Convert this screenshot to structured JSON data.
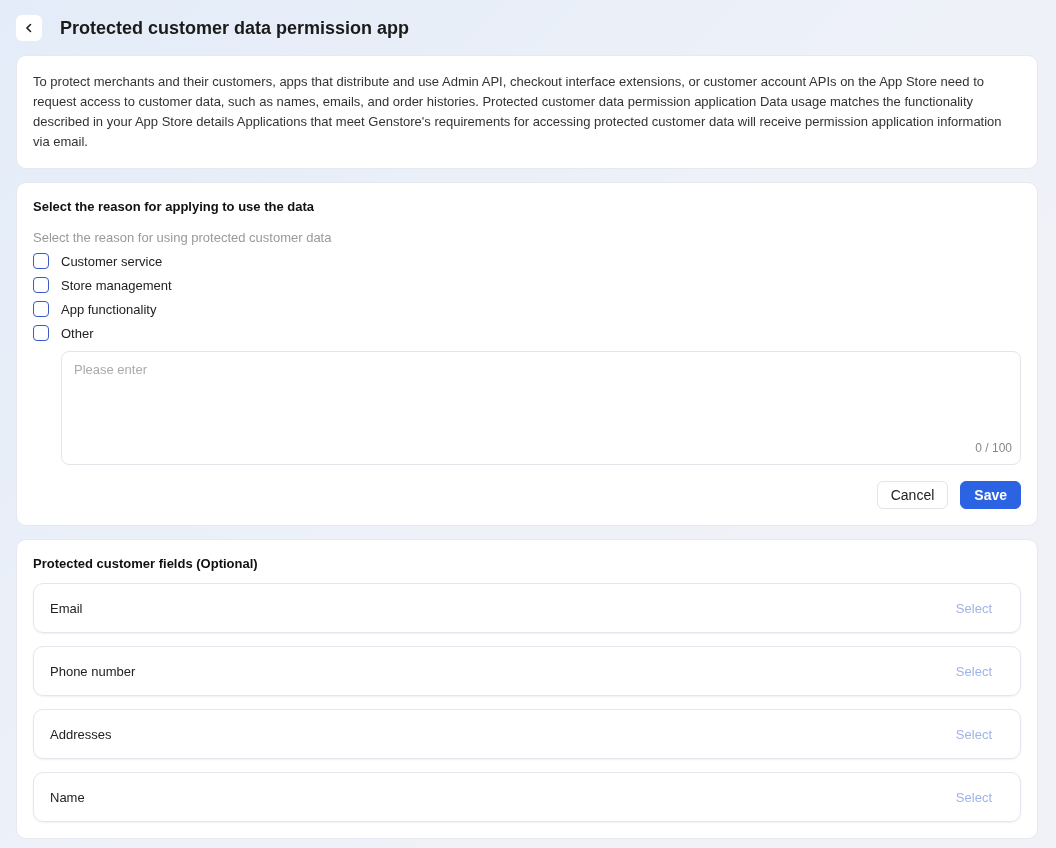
{
  "header": {
    "title": "Protected customer data permission app"
  },
  "intro": {
    "text": "To protect merchants and their customers, apps that distribute and use Admin API, checkout interface extensions, or customer account APIs on the App Store need to request access to customer data, such as names, emails, and order histories. Protected customer data permission application Data usage matches the functionality described in your App Store details Applications that meet Genstore's requirements for accessing protected customer data will receive permission application information via email."
  },
  "reasons": {
    "title": "Select the reason for applying to use the data",
    "hint": "Select the reason for using protected customer data",
    "options": [
      {
        "label": "Customer service",
        "checked": false
      },
      {
        "label": "Store management",
        "checked": false
      },
      {
        "label": "App functionality",
        "checked": false
      },
      {
        "label": "Other",
        "checked": false
      }
    ],
    "textarea": {
      "placeholder": "Please enter",
      "counter": "0 / 100"
    },
    "buttons": [
      {
        "label": "Cancel",
        "kind": "secondary"
      },
      {
        "label": "Save",
        "kind": "primary"
      }
    ]
  },
  "fields": {
    "title": "Protected customer fields (Optional)",
    "items": [
      {
        "label": "Email",
        "action": "Select"
      },
      {
        "label": "Phone number",
        "action": "Select"
      },
      {
        "label": "Addresses",
        "action": "Select"
      },
      {
        "label": "Name",
        "action": "Select"
      }
    ]
  }
}
